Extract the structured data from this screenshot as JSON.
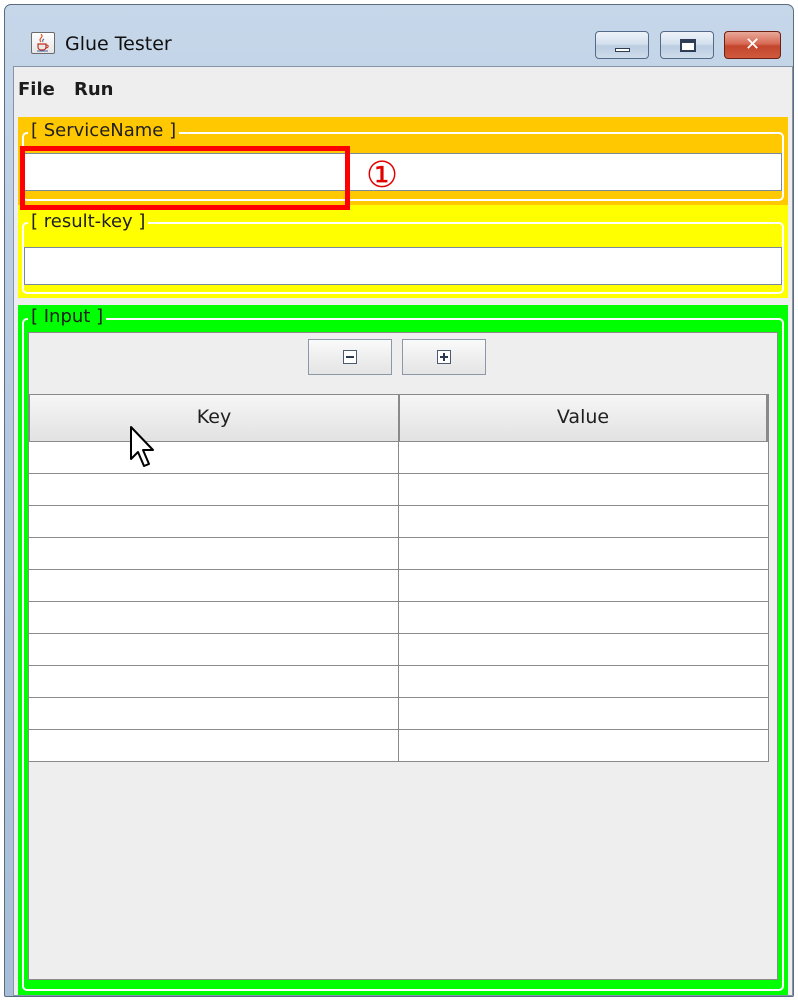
{
  "window": {
    "title": "Glue Tester",
    "icon": "java-cup-icon",
    "controls": {
      "minimize": "minimize-icon",
      "maximize": "maximize-icon",
      "close_glyph": "✕"
    }
  },
  "menu": {
    "items": [
      "File",
      "Run"
    ]
  },
  "service_panel": {
    "title": "[ ServiceName ]",
    "value": "",
    "color": "#ffc800"
  },
  "result_key_panel": {
    "title": "[ result-key ]",
    "value": "",
    "color": "#ffff00"
  },
  "input_panel": {
    "title": "[ Input ]",
    "color": "#00ff00",
    "toolbar": {
      "remove_icon": "minus-box-icon",
      "add_icon": "plus-box-icon"
    },
    "table": {
      "columns": [
        "Key",
        "Value"
      ],
      "rows": [
        [
          "",
          ""
        ],
        [
          "",
          ""
        ],
        [
          "",
          ""
        ],
        [
          "",
          ""
        ],
        [
          "",
          ""
        ],
        [
          "",
          ""
        ],
        [
          "",
          ""
        ],
        [
          "",
          ""
        ],
        [
          "",
          ""
        ],
        [
          "",
          ""
        ]
      ]
    }
  },
  "annotation": {
    "marker": "①",
    "color": "#ff0000"
  }
}
